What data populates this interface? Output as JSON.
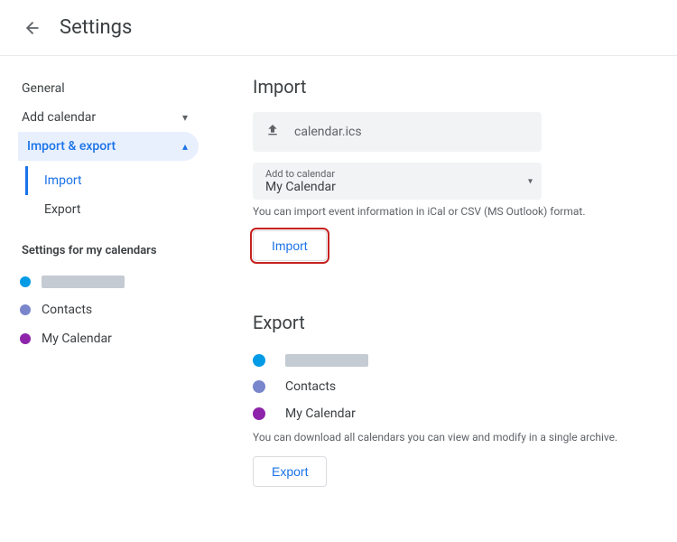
{
  "header": {
    "title": "Settings"
  },
  "sidebar": {
    "items": [
      {
        "label": "General",
        "expandable": false
      },
      {
        "label": "Add calendar",
        "expandable": true
      },
      {
        "label": "Import & export",
        "expandable": true,
        "active": true
      }
    ],
    "sub_items": [
      {
        "label": "Import",
        "active": true
      },
      {
        "label": "Export",
        "active": false
      }
    ],
    "calendars_heading": "Settings for my calendars",
    "calendars": [
      {
        "label": "",
        "color": "#039be5",
        "redacted": true
      },
      {
        "label": "Contacts",
        "color": "#7986cb"
      },
      {
        "label": "My Calendar",
        "color": "#8e24aa"
      }
    ]
  },
  "import": {
    "title": "Import",
    "filename": "calendar.ics",
    "select_label": "Add to calendar",
    "select_value": "My Calendar",
    "hint": "You can import event information in iCal or CSV (MS Outlook) format.",
    "button_label": "Import"
  },
  "export": {
    "title": "Export",
    "calendars": [
      {
        "label": "",
        "color": "#039be5",
        "redacted": true
      },
      {
        "label": "Contacts",
        "color": "#7986cb"
      },
      {
        "label": "My Calendar",
        "color": "#8e24aa"
      }
    ],
    "hint": "You can download all calendars you can view and modify in a single archive.",
    "button_label": "Export"
  },
  "colors": {
    "accent": "#1a73e8"
  }
}
